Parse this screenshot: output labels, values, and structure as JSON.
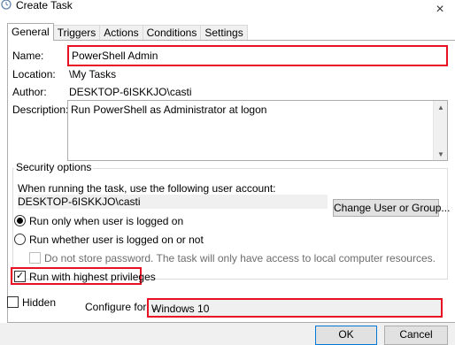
{
  "window": {
    "title": "Create Task",
    "close_glyph": "×",
    "icon": "task-scheduler-icon"
  },
  "tabs": [
    {
      "label": "General",
      "active": true
    },
    {
      "label": "Triggers",
      "active": false
    },
    {
      "label": "Actions",
      "active": false
    },
    {
      "label": "Conditions",
      "active": false
    },
    {
      "label": "Settings",
      "active": false
    }
  ],
  "general": {
    "name_label": "Name:",
    "name_value": "PowerShell Admin",
    "location_label": "Location:",
    "location_value": "\\My Tasks",
    "author_label": "Author:",
    "author_value": "DESKTOP-6ISKKJO\\casti",
    "description_label": "Description:",
    "description_value": "Run PowerShell as Administrator at logon"
  },
  "security": {
    "group_title": "Security options",
    "account_prompt": "When running the task, use the following user account:",
    "account_value": "DESKTOP-6ISKKJO\\casti",
    "change_button": "Change User or Group...",
    "radio_logged_on": "Run only when user is logged on",
    "radio_logged_on_checked": true,
    "radio_whether": "Run whether user is logged on or not",
    "radio_whether_checked": false,
    "no_store_password": "Do not store password.  The task will only have access to local computer resources.",
    "no_store_password_checked": false,
    "highest_privileges": "Run with highest privileges",
    "highest_privileges_checked": true
  },
  "bottom": {
    "hidden_label": "Hidden",
    "hidden_checked": false,
    "configure_label": "Configure for:",
    "configure_value": "Windows 10"
  },
  "footer": {
    "ok_label": "OK",
    "cancel_label": "Cancel"
  },
  "colors": {
    "highlight": "#e81123",
    "panel_border": "#adadad",
    "button_bg": "#e1e1e1"
  }
}
